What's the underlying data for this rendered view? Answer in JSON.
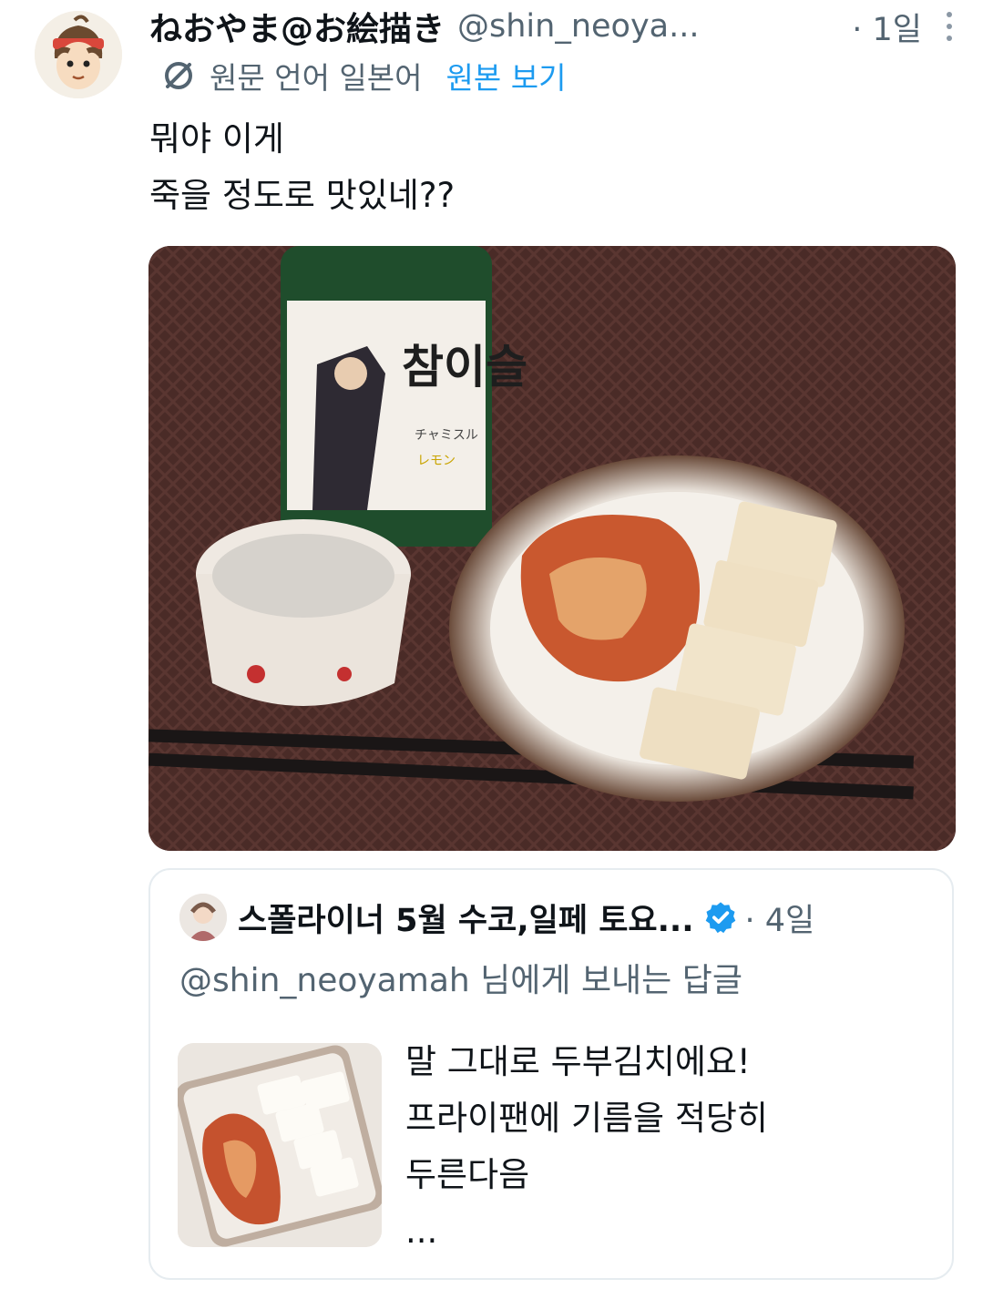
{
  "tweet": {
    "display_name": "ねおやま@お絵描き",
    "handle": "@shin_neoya...",
    "time": "· 1일",
    "translation": {
      "icon": "translate-icon",
      "label": "원문 언어 일본어",
      "show_original": "원본 보기"
    },
    "text_lines": [
      "뭐야 이게",
      "죽을 정도로 맛있네??"
    ],
    "media": {
      "bottle_label_title": "참이슬",
      "bottle_label_sub": "チャミスル",
      "bottle_label_flavor": "レモン"
    }
  },
  "quote": {
    "display_name": "스폴라이너 5월 수코,일페 토요...",
    "verified_icon": "verified-badge-icon",
    "verified_color": "#1d9bf0",
    "time": "· 4일",
    "reply_to": "@shin_neoyamah 님에게 보내는 답글",
    "text_lines": [
      "말 그대로 두부김치에요!",
      "프라이팬에 기름을 적당히",
      "두른다음",
      "..."
    ]
  },
  "colors": {
    "link": "#1d9bf0",
    "secondary_text": "#536471",
    "primary_text": "#0f1419"
  }
}
